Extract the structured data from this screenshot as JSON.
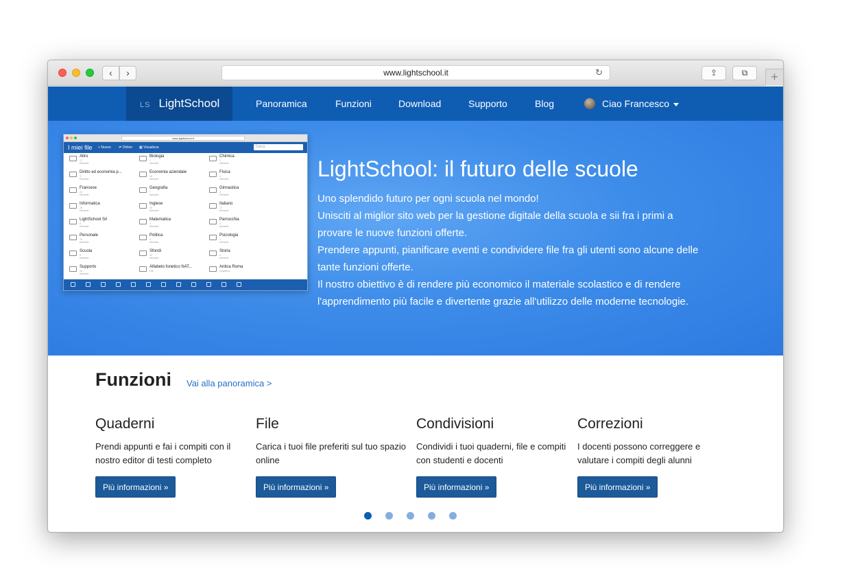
{
  "browser": {
    "url": "www.lightschool.it",
    "back_glyph": "‹",
    "forward_glyph": "›",
    "reload_glyph": "↻",
    "share_glyph": "⇪",
    "tabs_glyph": "⧉",
    "newtab_glyph": "+"
  },
  "nav": {
    "brand_mark": "LS",
    "brand": "LightSchool",
    "links": [
      "Panoramica",
      "Funzioni",
      "Download",
      "Supporto",
      "Blog"
    ],
    "user": "Ciao Francesco"
  },
  "hero": {
    "title": "LightSchool: il futuro delle scuole",
    "lines": [
      "Uno splendido futuro per ogni scuola nel mondo!",
      "Unisciti al miglior sito web per la gestione digitale della scuola e sii fra i primi a",
      "provare le nuove funzioni offerte.",
      "Prendere appunti, pianificare eventi e condividere file fra gli utenti sono alcune delle",
      "tante funzioni offerte.",
      "Il nostro obiettivo è di rendere più economico il materiale scolastico e di rendere",
      "l'apprendimento più facile e divertente grazie all'utilizzo delle moderne tecnologie."
    ],
    "preview": {
      "url": "www.lightschool.it",
      "title": "I miei file",
      "actions": [
        "+ Nuovo",
        "⇌ Online",
        "▦ Visualizza"
      ],
      "search_placeholder": "Cerca",
      "items": [
        {
          "label": "Altro",
          "sub": "17 elementi"
        },
        {
          "label": "Biologia",
          "sub": "7 elementi"
        },
        {
          "label": "Chimica",
          "sub": "7 elementi"
        },
        {
          "label": "Diritto ed economia p...",
          "sub": "3 elementi"
        },
        {
          "label": "Economia aziendale",
          "sub": "16 elementi"
        },
        {
          "label": "Fisica",
          "sub": "3 elementi"
        },
        {
          "label": "Francese",
          "sub": "22 elementi"
        },
        {
          "label": "Geografia",
          "sub": "7 elementi"
        },
        {
          "label": "Ginnastica",
          "sub": "4 elementi"
        },
        {
          "label": "Informatica",
          "sub": "26 elementi"
        },
        {
          "label": "Inglese",
          "sub": "75 elementi"
        },
        {
          "label": "Italiano",
          "sub": "17 elementi"
        },
        {
          "label": "LightSchool Srl",
          "sub": "5 elementi"
        },
        {
          "label": "Matematica",
          "sub": "4 elementi"
        },
        {
          "label": "Parrocchia",
          "sub": "2 elementi"
        },
        {
          "label": "Personale",
          "sub": "74 elementi"
        },
        {
          "label": "Politica",
          "sub": "2 elementi"
        },
        {
          "label": "Psicologia",
          "sub": "1 elementi"
        },
        {
          "label": "Scuola",
          "sub": "9 elementi"
        },
        {
          "label": "Sfondi",
          "sub": "12 elementi"
        },
        {
          "label": "Storia",
          "sub": "4 elementi"
        },
        {
          "label": "Supporto",
          "sub": "16 elementi"
        },
        {
          "label": "Alfabeto fonetico NAT...",
          "sub": "File"
        },
        {
          "label": "Antica Roma",
          "sub": "Quaderno"
        }
      ]
    }
  },
  "features": {
    "title": "Funzioni",
    "link": "Vai alla panoramica >",
    "items": [
      {
        "title": "Quaderni",
        "text": "Prendi appunti e fai i compiti con il nostro editor di testi completo",
        "button": "Più informazioni »"
      },
      {
        "title": "File",
        "text": "Carica i tuoi file preferiti sul tuo spazio online",
        "button": "Più informazioni »"
      },
      {
        "title": "Condivisioni",
        "text": "Condividi i tuoi quaderni, file e compiti con studenti e docenti",
        "button": "Più informazioni »"
      },
      {
        "title": "Correzioni",
        "text": "I docenti possono correggere e valutare i compiti degli alunni",
        "button": "Più informazioni »"
      }
    ],
    "carousel": {
      "count": 5,
      "active": 1
    }
  },
  "colors": {
    "nav_bg": "#0f5db3",
    "hero_bg": "#3d8ce9",
    "button_bg": "#1c5a9a",
    "link": "#2a6fc8"
  }
}
